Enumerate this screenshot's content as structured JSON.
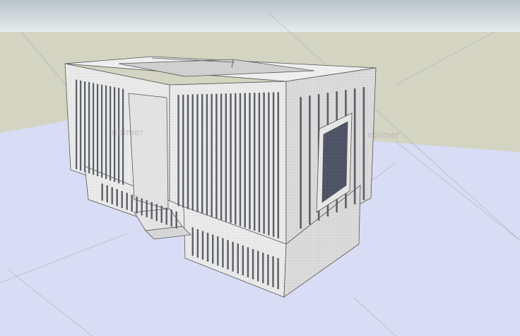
{
  "viewport": {
    "sky_color": "#dbe3e6",
    "ground_color": "#d3d3c1",
    "floor_color": "#d6daf3",
    "watermark_text": "nbimer",
    "watermarks": [
      "nbimer",
      "nbimer"
    ]
  },
  "building": {
    "roof_color": "#ececec",
    "facade_light": "#ececec",
    "facade_shadow": "#d8d8d8",
    "window_color": "#5b5f66",
    "glass_color": "#4a4f60"
  }
}
